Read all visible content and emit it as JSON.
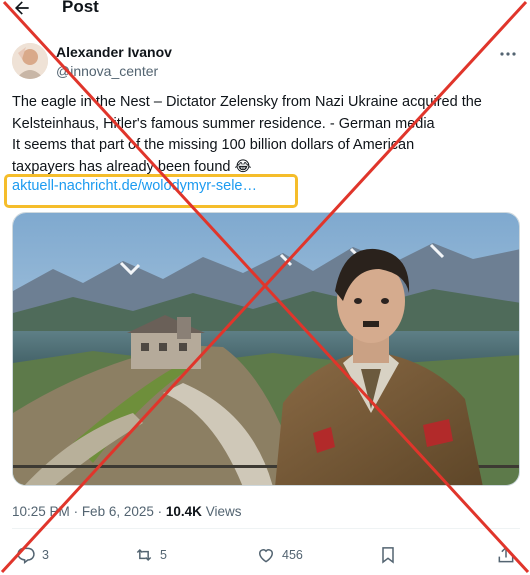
{
  "header": {
    "title": "Post"
  },
  "author": {
    "name": "Alexander Ivanov",
    "handle": "@innova_center"
  },
  "tweet": {
    "lines": [
      "The eagle in the Nest – Dictator Zelensky from Nazi Ukraine acquired the",
      "Kelsteinhaus, Hitler's famous summer residence. - German media",
      "It seems that part of the missing 100 billion dollars of American",
      "taxpayers has already been found 😂"
    ],
    "link": "aktuell-nachricht.de/wolodymyr-sele…"
  },
  "meta": {
    "time": "10:25 PM",
    "date": "Feb 6, 2025",
    "views_count": "10.4K",
    "views_label": "Views"
  },
  "actions": {
    "replies": "3",
    "reposts": "5",
    "likes": "456"
  },
  "colors": {
    "accent": "#1d9bf0",
    "highlight": "#f5bd2a",
    "cross": "#e0352b"
  }
}
